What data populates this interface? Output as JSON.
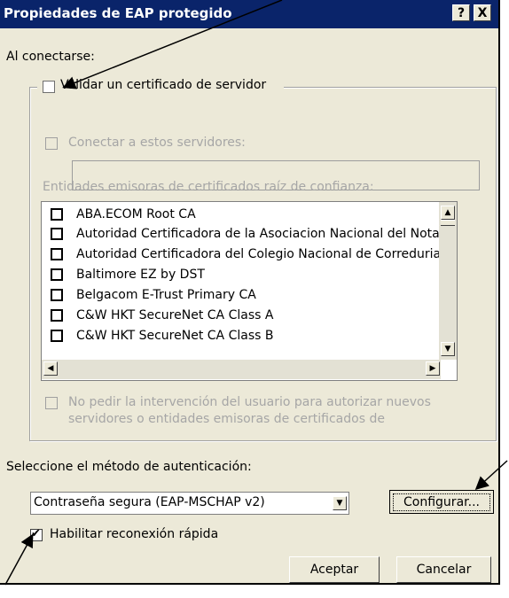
{
  "window": {
    "title": "Propiedades de EAP protegido",
    "help_label": "?",
    "close_label": "X"
  },
  "connect_label": "Al conectarse:",
  "validate": {
    "label": "Validar un certificado de servidor",
    "checked": false
  },
  "connect_servers": {
    "label": "Conectar a estos servidores:",
    "value": ""
  },
  "trusted_roots": {
    "label": "Entidades emisoras de certificados raíz de confianza:",
    "items": [
      "ABA.ECOM Root CA",
      "Autoridad Certificadora de la Asociacion Nacional del Notaria",
      "Autoridad Certificadora del Colegio Nacional de Correduria P.",
      "Baltimore EZ by DST",
      "Belgacom E-Trust Primary CA",
      "C&W HKT SecureNet CA Class A",
      "C&W HKT SecureNet CA Class B"
    ]
  },
  "no_prompt": {
    "line1": "No pedir la intervención del usuario para autorizar nuevos",
    "line2": "servidores o entidades emisoras de certificados de"
  },
  "auth": {
    "label": "Seleccione el método de autenticación:",
    "selected": "Contraseña segura (EAP-MSCHAP v2)",
    "configure_label": "Configurar..."
  },
  "fast_reconnect": {
    "label": "Habilitar reconexión rápida",
    "checked": true
  },
  "buttons": {
    "ok": "Aceptar",
    "cancel": "Cancelar"
  }
}
